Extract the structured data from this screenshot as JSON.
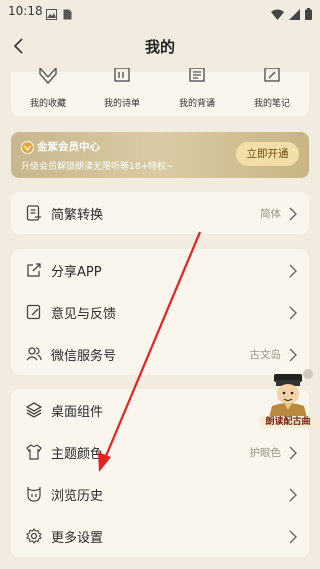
{
  "status": {
    "time": "10:18"
  },
  "header": {
    "title": "我的"
  },
  "quick_actions": [
    {
      "label": "我的收藏",
      "icon": "favorites-icon"
    },
    {
      "label": "我的诗单",
      "icon": "poem-list-icon"
    },
    {
      "label": "我的背诵",
      "icon": "recite-icon"
    },
    {
      "label": "我的笔记",
      "icon": "notes-icon"
    }
  ],
  "vip": {
    "title": "金紫会员中心",
    "desc": "升级会员解锁朗读无限听等18+特权~",
    "button": "立即开通"
  },
  "settings": {
    "convert": {
      "label": "简繁转换",
      "value": "简体"
    },
    "share": {
      "label": "分享APP"
    },
    "feedback": {
      "label": "意见与反馈"
    },
    "wechat": {
      "label": "微信服务号",
      "value": "古文岛"
    },
    "widget": {
      "label": "桌面组件"
    },
    "theme": {
      "label": "主题颜色",
      "value": "护眼色"
    },
    "history": {
      "label": "浏览历史"
    },
    "more": {
      "label": "更多设置"
    }
  },
  "floating": {
    "caption": "朗读配古曲"
  },
  "colors": {
    "background": "#f1ecdf",
    "card": "#faf6ee",
    "vip_gold": "#c8b78d",
    "annotation_arrow": "#e8201f"
  }
}
